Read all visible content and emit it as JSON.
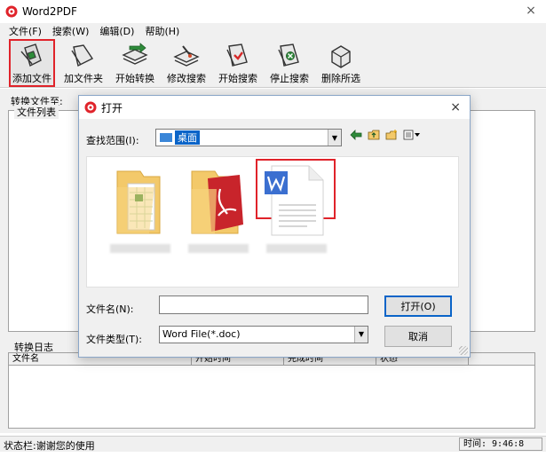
{
  "window": {
    "title": "Word2PDF",
    "close_glyph": "×"
  },
  "menu": [
    {
      "label": "文件(F)"
    },
    {
      "label": "搜索(W)"
    },
    {
      "label": "编辑(D)"
    },
    {
      "label": "帮助(H)"
    }
  ],
  "toolbar": [
    {
      "label": "添加文件",
      "icon": "add-file-icon",
      "active": true
    },
    {
      "label": "加文件夹",
      "icon": "add-folder-icon",
      "active": false
    },
    {
      "label": "开始转换",
      "icon": "start-convert-icon",
      "active": false
    },
    {
      "label": "修改搜索",
      "icon": "modify-search-icon",
      "active": false
    },
    {
      "label": "开始搜索",
      "icon": "start-search-icon",
      "active": false
    },
    {
      "label": "停止搜索",
      "icon": "stop-search-icon",
      "active": false
    },
    {
      "label": "删除所选",
      "icon": "delete-selected-icon",
      "active": false
    }
  ],
  "main": {
    "convert_to_label": "转换文件至:",
    "file_list_title": "文件列表",
    "log_title": "转换日志",
    "log_columns": [
      {
        "label": "文件名"
      },
      {
        "label": "开始时间"
      },
      {
        "label": "完成时间"
      },
      {
        "label": "状态"
      }
    ]
  },
  "statusbar": {
    "status_text": "状态栏:谢谢您的使用",
    "time_text": "时间: 9:46:8"
  },
  "dialog": {
    "title": "打开",
    "close_glyph": "×",
    "look_in_label": "查找范围(I):",
    "look_in_value": "桌面",
    "file_name_label": "文件名(N):",
    "file_name_value": "",
    "file_type_label": "文件类型(T):",
    "file_type_value": "Word File(*.doc)",
    "open_button": "打开(O)",
    "cancel_button": "取消",
    "files": [
      {
        "type": "excel-folder",
        "icon": "excel-folder-icon",
        "caption": ""
      },
      {
        "type": "pdf-folder",
        "icon": "pdf-folder-icon",
        "caption": ""
      },
      {
        "type": "word-document",
        "icon": "word-document-icon",
        "caption": "",
        "selected": true
      }
    ]
  },
  "colors": {
    "highlight_red": "#e0232a",
    "selection_blue": "#0a64c8",
    "word_blue": "#3b6fd0",
    "pdf_red": "#c8242b",
    "folder_yellow": "#f3c96a"
  }
}
